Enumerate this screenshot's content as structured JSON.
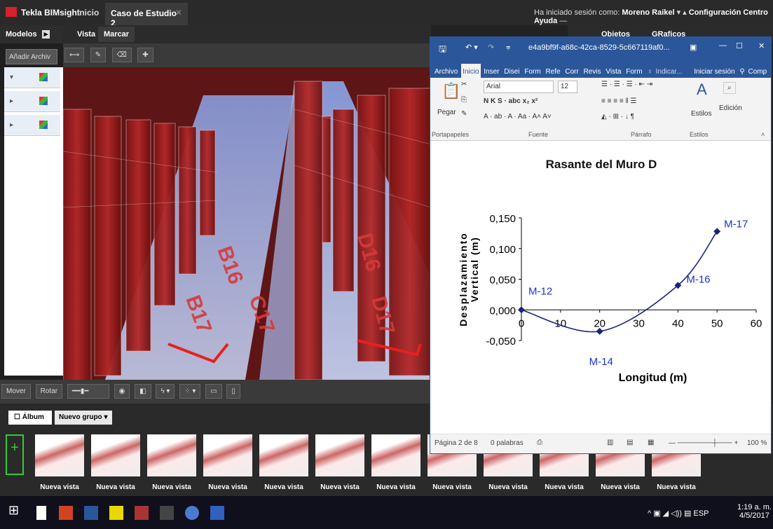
{
  "tekla": {
    "app_name": "Tekla BIMsight",
    "home_label": "Inicio",
    "project_tab": "Caso de Estudio 2",
    "login_prefix": "Ha iniciado sesión como:",
    "user": "Moreno Raikel",
    "config_label": "Configuración",
    "help_label": "Centro Ayuda"
  },
  "left_panel": {
    "tab_models": "Modelos",
    "add_button": "Añadir Archiv"
  },
  "viewport": {
    "tab_view": "Vista",
    "tab_mark": "Marcar",
    "labels": [
      "B16",
      "C17",
      "B17",
      "D16",
      "D17"
    ]
  },
  "right_panel": {
    "tab_objects": "Objetos",
    "tab_graphics": "GRaficos"
  },
  "bottom_toolbar": {
    "move": "Mover",
    "rotate": "Rotar"
  },
  "album": {
    "album_tab": "Álbum",
    "group_tab": "Nuevo grupo",
    "thumb_label": "Nueva vista",
    "thumbs": [
      "Nueva vista",
      "Nueva vista",
      "Nueva vista",
      "Nueva vista",
      "Nueva vista",
      "Nueva vista",
      "Nueva vista",
      "Nueva vista",
      "Nueva vista",
      "Nueva vista",
      "Nueva vista",
      "Nueva vista"
    ]
  },
  "taskbar": {
    "lang": "ESP",
    "time": "1:19 a. m.",
    "date": "4/5/2017"
  },
  "word": {
    "doc_title": "e4a9bf9f-a68c-42ca-8529-5c667119af0...",
    "tabs": [
      "Archivo",
      "Inicio",
      "Inser",
      "Disei",
      "Form",
      "Refe",
      "Corr",
      "Revis",
      "Vista",
      "Form"
    ],
    "tell_me": "Indicar...",
    "signin": "Iniciar sesión",
    "share": "Comp",
    "font_name": "Arial",
    "font_size": "12",
    "paste_label": "Pegar",
    "styles_label": "Estilos",
    "edit_label": "Edición",
    "group_clipboard": "Portapapeles",
    "group_font": "Fuente",
    "group_paragraph": "Párrafo",
    "group_styles": "Estilos",
    "status_page": "Página 2 de 8",
    "status_words": "0 palabras",
    "zoom": "100 %"
  },
  "chart_data": {
    "type": "line",
    "title": "Rasante del Muro D",
    "xlabel": "Longitud (m)",
    "ylabel_line1": "Desplazamiento",
    "ylabel_line2": "Vertical (m)",
    "xlim": [
      0,
      60
    ],
    "ylim": [
      -0.05,
      0.15
    ],
    "x_ticks": [
      "0",
      "10",
      "20",
      "30",
      "40",
      "50",
      "60"
    ],
    "y_ticks": [
      "-0,050",
      "0,000",
      "0,050",
      "0,100",
      "0,150"
    ],
    "points": [
      {
        "x": 0,
        "y": 0.0,
        "label": "M-12"
      },
      {
        "x": 20,
        "y": -0.035,
        "label": "M-14"
      },
      {
        "x": 40,
        "y": 0.04,
        "label": "M-16"
      },
      {
        "x": 50,
        "y": 0.128,
        "label": "M-17"
      }
    ],
    "color": "#1a237e",
    "label_color": "#1a35c8"
  }
}
